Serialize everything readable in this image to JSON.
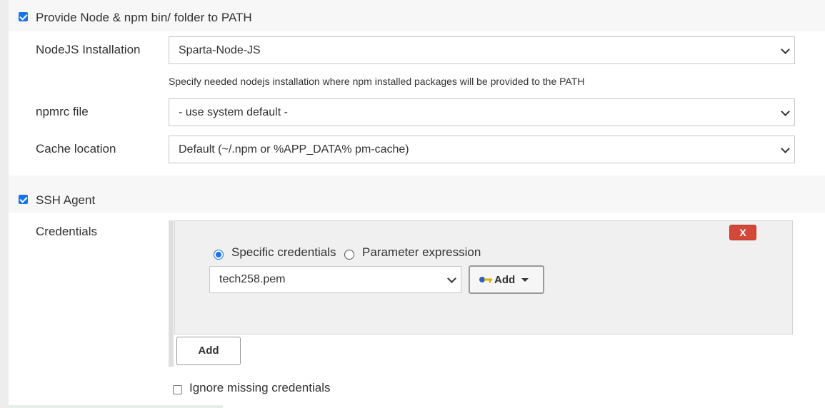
{
  "node_section": {
    "checkbox_label": "Provide Node & npm bin/ folder to PATH",
    "checked": true,
    "nodejs_installation": {
      "label": "NodeJS Installation",
      "value": "Sparta-Node-JS",
      "hint": "Specify needed nodejs installation where npm installed packages will be provided to the PATH"
    },
    "npmrc": {
      "label": "npmrc file",
      "value": "- use system default -"
    },
    "cache": {
      "label": "Cache location",
      "value": "Default (~/.npm or %APP_DATA% pm-cache)"
    }
  },
  "ssh_section": {
    "checkbox_label": "SSH Agent",
    "checked": true,
    "credentials_label": "Credentials",
    "delete_label": "X",
    "radio_specific": "Specific credentials",
    "radio_parameter": "Parameter expression",
    "selected_radio": "specific",
    "credential_value": "tech258.pem",
    "add_dropdown_label": "Add",
    "add_button_label": "Add",
    "ignore_missing_label": "Ignore missing credentials",
    "ignore_missing_checked": false
  },
  "colors": {
    "accent": "#1a73e8",
    "danger": "#d24939"
  }
}
